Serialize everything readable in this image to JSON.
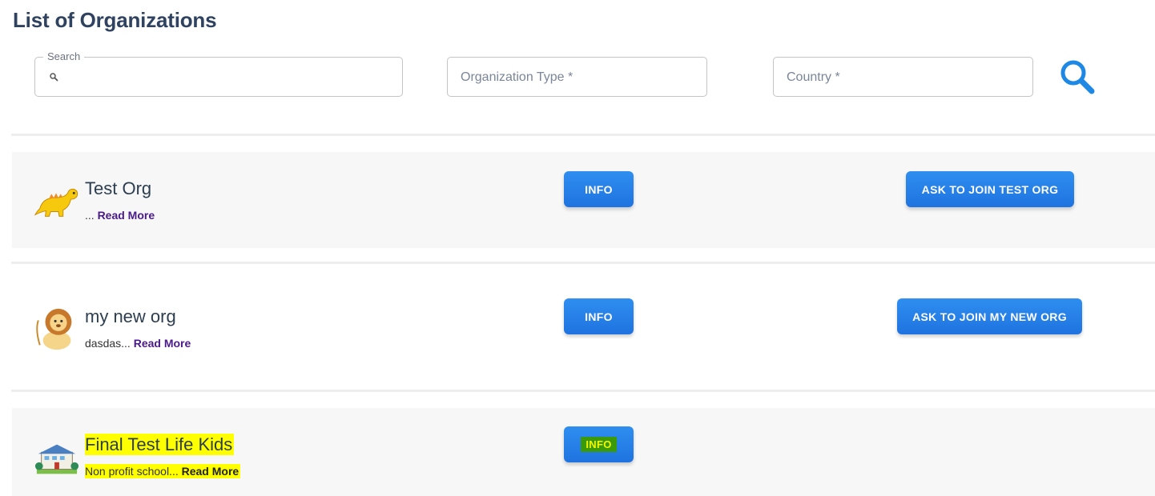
{
  "page_title": "List of Organizations",
  "filters": {
    "search_label": "Search",
    "search_value": "",
    "org_type_placeholder": "Organization Type *",
    "country_placeholder": "Country *"
  },
  "organizations": [
    {
      "name": "Test Org",
      "description": "...",
      "read_more": "Read More",
      "info_label": "INFO",
      "join_label": "ASK TO JOIN TEST ORG",
      "avatar": "dinosaur-avatar"
    },
    {
      "name": "my new org",
      "description": "dasdas...",
      "read_more": "Read More",
      "info_label": "INFO",
      "join_label": "ASK TO JOIN MY NEW ORG",
      "avatar": "lion-avatar"
    },
    {
      "name": "Final Test Life Kids",
      "description": "Non profit school...",
      "read_more": "Read More",
      "info_label": "INFO",
      "avatar": "school-avatar",
      "highlighted": true
    }
  ],
  "colors": {
    "primary_button": "#1f73e0",
    "read_more": "#4a1a8a",
    "highlight": "#ffff00",
    "title": "#2f4260"
  }
}
